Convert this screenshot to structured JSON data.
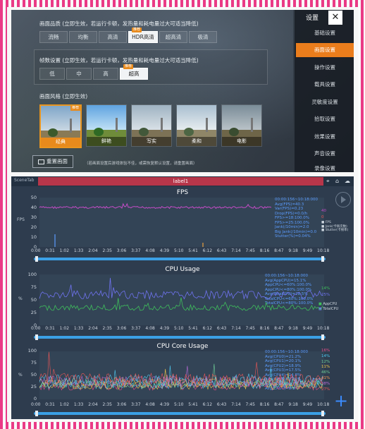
{
  "game_settings": {
    "quality_label": "画面品质 (立即生效，若运行卡顿，发热量和耗电量过大可适当降低)",
    "quality_options": [
      "流畅",
      "均衡",
      "高清",
      "HDR高清",
      "超高清",
      "极清"
    ],
    "quality_selected": "HDR高清",
    "quality_tag": "推荐",
    "fps_label": "帧数设置 (立即生效，若运行卡顿，发热量和耗电量过大可适当降低)",
    "fps_options": [
      "低",
      "中",
      "高",
      "超高"
    ],
    "fps_selected": "超高",
    "fps_tag": "推荐",
    "style_label": "画面风格 (立即生效)",
    "styles": [
      "经典",
      "鲜艳",
      "写实",
      "柔和",
      "电影"
    ],
    "style_selected": "经典",
    "style_tag": "推荐",
    "reset_label": "重置画面",
    "note": "（若画面设置后游戏体验不佳，或需恢复默认设置，请重置画面）",
    "sidebar_title": "设置",
    "close_icon": "✕",
    "sidebar_items": [
      "基础设置",
      "画面设置",
      "操作设置",
      "载具设置",
      "灵敏度设置",
      "拾取设置",
      "效果设置",
      "声音设置",
      "录像设置"
    ],
    "sidebar_active": "画面设置"
  },
  "perf": {
    "scene_tab": "SceneTab",
    "label_tab": "label1",
    "header_icons": [
      "location-icon",
      "home-icon",
      "cloud-icon"
    ],
    "x_ticks": [
      "0:00",
      "0:31",
      "1:02",
      "1:33",
      "2:04",
      "2:35",
      "3:06",
      "3:37",
      "4:08",
      "4:39",
      "5:10",
      "5:41",
      "6:12",
      "6:43",
      "7:14",
      "7:45",
      "8:16",
      "8:47",
      "9:18",
      "9:49",
      "10:18"
    ],
    "fps_chart": {
      "title": "FPS",
      "ylabel": "FPS",
      "y_ticks": [
        "50",
        "40",
        "30",
        "20",
        "10",
        "0"
      ],
      "legend_lines": [
        "00:00:156~10:18:000",
        "Avg(FPS)=40.3",
        "Var(FPS)=0.23",
        "Drop(FPS)=0.0/h",
        "FPS>=18:100.0%",
        "FPS>=25:100.0%",
        "Jank(/10min)=2.0",
        "Big Jank(/10min)=0.0",
        "Stutter(%)=0.04%"
      ],
      "right_values": [
        "40",
        "0"
      ],
      "series_legend": [
        "FPS",
        "Jank(卡顿次数)",
        "Stutter(卡顿率)"
      ]
    },
    "cpu_chart": {
      "title": "CPU Usage",
      "ylabel": "%",
      "y_ticks": [
        "100",
        "75",
        "50",
        "25",
        "0"
      ],
      "legend_lines": [
        "00:00:156~10:18:000",
        "Avg(AppCPU)=15.1%",
        "AppCPU<=60%:100.0%",
        "AppCPU<=80%:100.0%",
        "Avg(TotalCPU)=28.5%",
        "TotalCPU<=60%:100.0%",
        "TotalCPU<=80%:100.0%"
      ],
      "right_values": [
        "14%",
        "25%"
      ],
      "series_legend": [
        "AppCPU",
        "TotalCPU"
      ]
    },
    "core_chart": {
      "title": "CPU Core Usage",
      "ylabel": "%",
      "y_ticks": [
        "100",
        "75",
        "50",
        "25",
        "0"
      ],
      "legend_lines": [
        "00:00:156~10:18:000",
        "Avg(CPU0)=21.2%",
        "Avg(CPU1)=20.1%",
        "Avg(CPU2)=18.9%",
        "Avg(CPU3)=17.5%",
        "Avg(CPU4)=14.8%",
        "Avg(CPU5)=11.6%",
        "Avg(CPU6)=9.3%",
        "Avg(CPU7)=8.1%"
      ],
      "right_values": [
        "16%",
        "14%",
        "12%",
        "11%",
        "46%",
        "41%",
        "38%",
        "27%"
      ]
    },
    "colors": {
      "fps": "#c54cc7",
      "app_cpu": "#3fbf5c",
      "total_cpu": "#6f73f0",
      "legend_text": "#5b9cff",
      "cores": [
        "#e84d8a",
        "#f2c94c",
        "#4cc9f0",
        "#6fcf97",
        "#f2994a",
        "#bb6bd9",
        "#56ccf2",
        "#eb5757"
      ]
    }
  }
}
